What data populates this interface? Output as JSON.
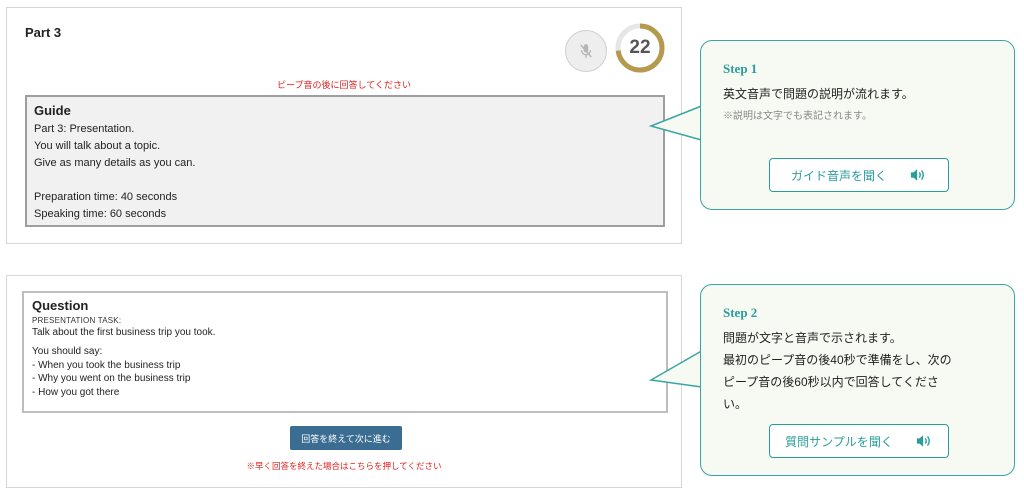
{
  "part": {
    "title": "Part 3"
  },
  "timer": {
    "value": "22",
    "fraction": 0.73
  },
  "beep_note": "ピープ音の後に回答してください",
  "guide": {
    "title": "Guide",
    "lines": [
      "Part 3: Presentation.",
      "You will talk about a topic.",
      "Give as many details as you can.",
      "",
      "Preparation time: 40 seconds",
      "Speaking time: 60 seconds"
    ]
  },
  "question": {
    "title": "Question",
    "task_label": "PRESENTATION TASK:",
    "main": "Talk about the first business trip you took.",
    "lines": [
      "You should say:",
      "- When you took the business trip",
      "- Why you went on the business trip",
      "- How you got there"
    ]
  },
  "next_button": "回答を終えて次に進む",
  "early_note": "※早く回答を終えた場合はこちらを押してください",
  "step1": {
    "label": "Step 1",
    "text": "英文音声で問題の説明が流れます。",
    "note": "※説明は文字でも表記されます。",
    "button": "ガイド音声を聞く"
  },
  "step2": {
    "label": "Step 2",
    "lines": [
      "問題が文字と音声で示されます。",
      "最初のピープ音の後40秒で準備をし、次の",
      "ピープ音の後60秒以内で回答してくださ",
      "い。"
    ],
    "button": "質問サンプルを聞く"
  },
  "colors": {
    "accent_teal": "#2a9d9b",
    "callout_bg": "#f6faf2",
    "timer_gold": "#b59a4e",
    "alert_red": "#e02020",
    "primary_button": "#3a6d91"
  }
}
